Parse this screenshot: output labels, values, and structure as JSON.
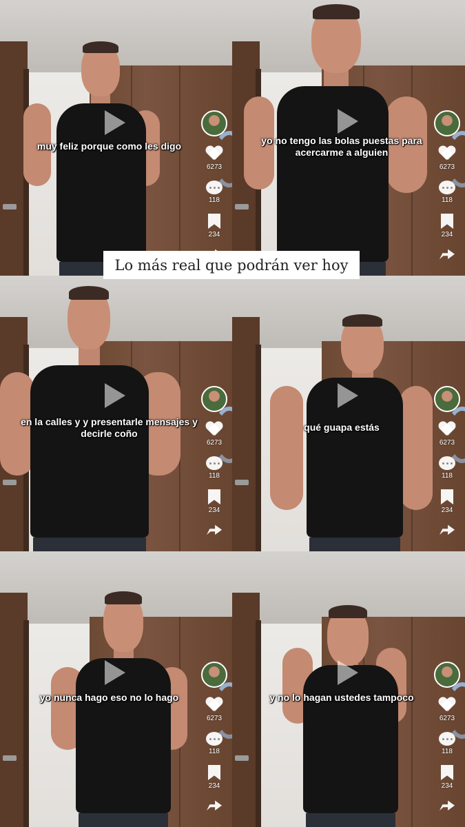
{
  "title": "Lo más real que podrán ver hoy",
  "frames": [
    {
      "caption": "muy feliz porque como les digo",
      "likes": "6273",
      "comments": "118",
      "saves": "234"
    },
    {
      "caption": "yo no tengo las bolas puestas para acercarme a alguien",
      "likes": "6273",
      "comments": "118",
      "saves": "234"
    },
    {
      "caption": "en la calles y y presentarle mensajes y decirle coño",
      "likes": "6273",
      "comments": "118",
      "saves": "234"
    },
    {
      "caption": "qué guapa estás",
      "likes": "6273",
      "comments": "118",
      "saves": "234"
    },
    {
      "caption": "yo nunca hago eso no lo hago",
      "likes": "6273",
      "comments": "118",
      "saves": "234"
    },
    {
      "caption": "y no lo hagan ustedes tampoco",
      "likes": "6273",
      "comments": "118",
      "saves": "234"
    }
  ],
  "icons": [
    "play-icon",
    "heart-icon",
    "comment-icon",
    "bookmark-icon",
    "share-icon",
    "avatar"
  ],
  "colors": {
    "tank": "#141414",
    "wood": "#6d4a34",
    "caption": "#ffffff",
    "banner": "#ffffff"
  }
}
